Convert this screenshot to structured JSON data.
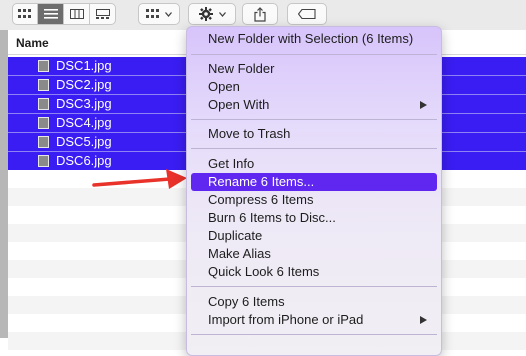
{
  "toolbar": {
    "view_buttons": [
      "icon-view",
      "list-view",
      "column-view",
      "gallery-view"
    ],
    "active_view": "list-view",
    "group_icon": "group-grid-icon",
    "action_icon": "gear-icon",
    "share_icon": "share-icon",
    "tag_icon": "tag-icon"
  },
  "list": {
    "header_name": "Name",
    "files": [
      "DSC1.jpg",
      "DSC2.jpg",
      "DSC3.jpg",
      "DSC4.jpg",
      "DSC5.jpg",
      "DSC6.jpg"
    ]
  },
  "context_menu": {
    "items": [
      {
        "label": "New Folder with Selection (6 Items)"
      },
      {
        "label": "New Folder"
      },
      {
        "label": "Open"
      },
      {
        "label": "Open With",
        "submenu": true
      },
      {
        "label": "Move to Trash"
      },
      {
        "label": "Get Info"
      },
      {
        "label": "Rename 6 Items...",
        "highlighted": true
      },
      {
        "label": "Compress 6 Items"
      },
      {
        "label": "Burn 6 Items to Disc..."
      },
      {
        "label": "Duplicate"
      },
      {
        "label": "Make Alias"
      },
      {
        "label": "Quick Look 6 Items"
      },
      {
        "label": "Copy 6 Items"
      },
      {
        "label": "Import from iPhone or iPad",
        "submenu": true
      }
    ]
  },
  "colors": {
    "selection": "#3a1df2",
    "menu_highlight": "#6027f0",
    "annotation_arrow": "#e8322a"
  }
}
